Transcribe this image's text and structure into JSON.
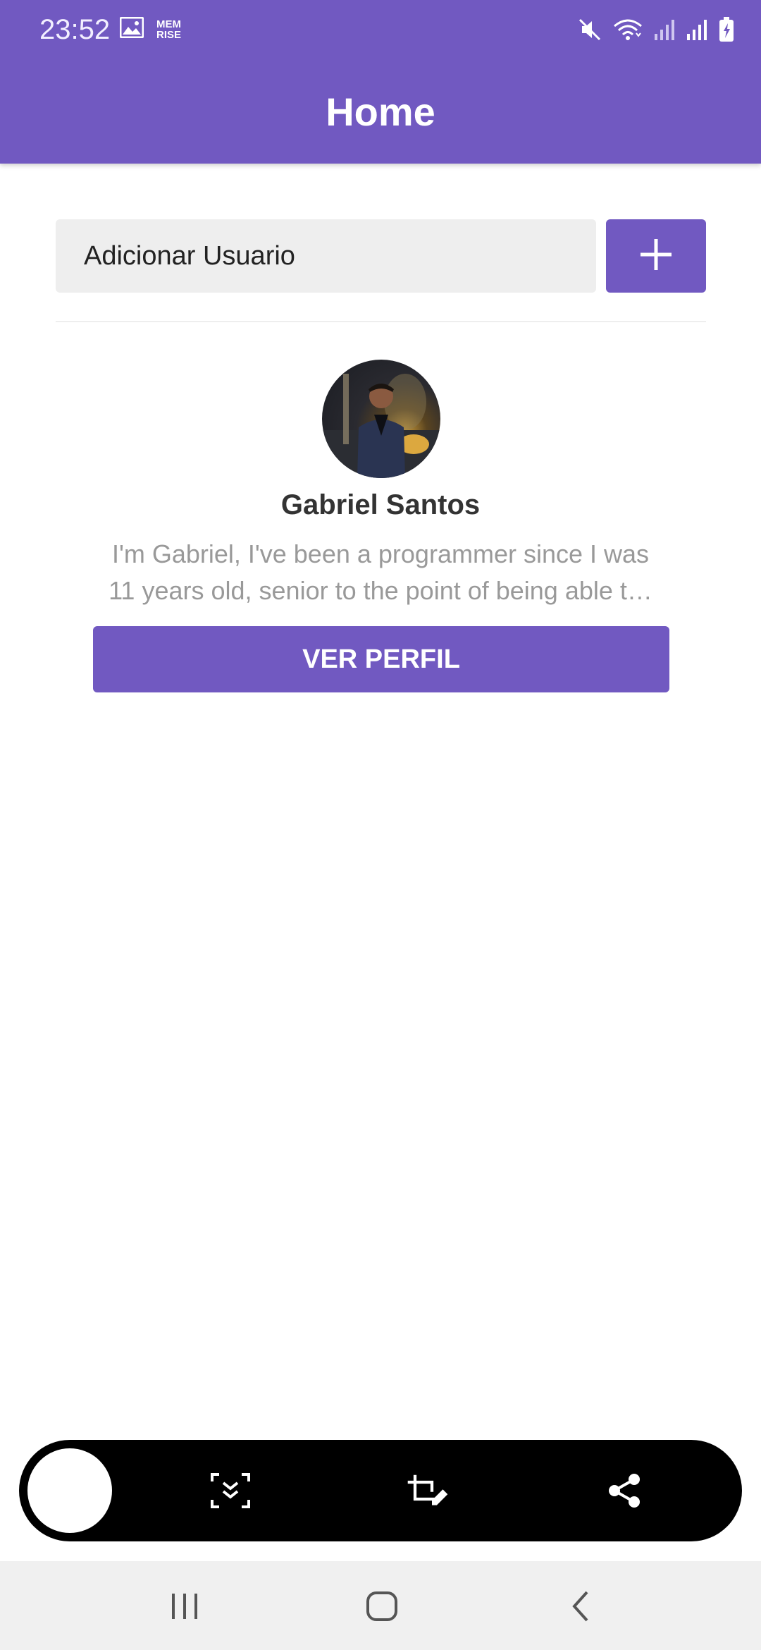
{
  "status_bar": {
    "time": "23:52",
    "left_icons": [
      "image-icon",
      "memrise-icon"
    ],
    "memrise_line1": "MEM",
    "memrise_line2": "RISE",
    "right_icons": [
      "mute-icon",
      "wifi-icon",
      "signal-icon",
      "signal-icon",
      "battery-charging-icon"
    ]
  },
  "header": {
    "title": "Home"
  },
  "add_user": {
    "placeholder": "Adicionar Usuario",
    "button_icon": "plus-icon"
  },
  "users": [
    {
      "name": "Gabriel Santos",
      "bio": "I'm Gabriel, I've been a programmer since I was 11 years old, senior to the point of being able t…",
      "button_label": "VER PERFIL"
    }
  ],
  "capture_toolbar": {
    "icons": [
      "scroll-capture-icon",
      "crop-edit-icon",
      "share-icon"
    ]
  },
  "nav_bar": {
    "icons": [
      "recents-icon",
      "home-icon",
      "back-icon"
    ]
  },
  "colors": {
    "primary": "#7159C1",
    "input_bg": "#EEEEEE",
    "bio_text": "#999999",
    "name_text": "#333333"
  }
}
